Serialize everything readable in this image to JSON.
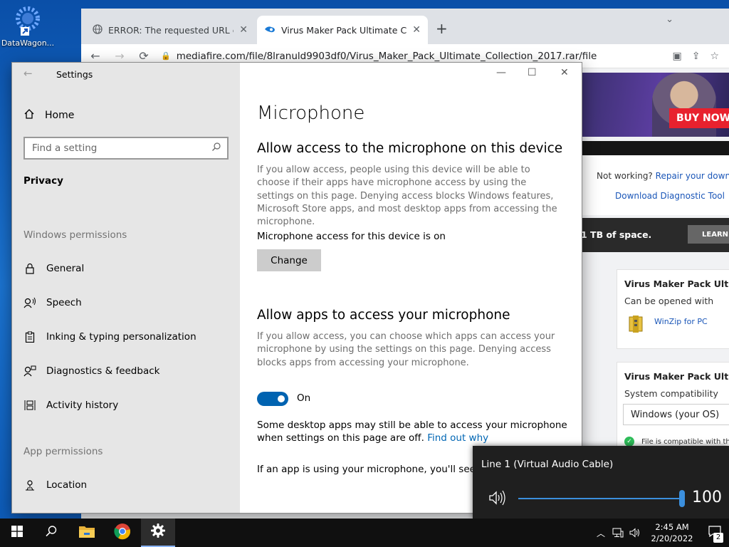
{
  "desktop": {
    "icon_label": "DataWagon..."
  },
  "browser": {
    "tabs": [
      {
        "title": "ERROR: The requested URL could",
        "active": false
      },
      {
        "title": "Virus Maker Pack Ultimate Collec",
        "active": true
      }
    ],
    "url": "mediafire.com/file/8lranuld9903df0/Virus_Maker_Pack_Ultimate_Collection_2017.rar/file"
  },
  "web": {
    "banner_cta": "BUY NOW",
    "not_working": "Not working?",
    "repair_link": "Repair your downloa",
    "diagnostic_link": "Download Diagnostic Tool",
    "space_text": "1 TB of space.",
    "learn_label": "LEARN",
    "card1": {
      "title": "Virus Maker Pack Ultima",
      "subtitle": "Can be opened with",
      "app_link": "WinZip for PC"
    },
    "card2": {
      "title": "Virus Maker Pack Ultima",
      "subtitle": "System compatibility",
      "os_value": "Windows (your OS)",
      "compat_text": "File is compatible with th"
    }
  },
  "settings": {
    "window_title": "Settings",
    "home_label": "Home",
    "search_placeholder": "Find a setting",
    "current_section": "Privacy",
    "windows_permissions_label": "Windows permissions",
    "windows_permissions": [
      "General",
      "Speech",
      "Inking & typing personalization",
      "Diagnostics & feedback",
      "Activity history"
    ],
    "app_permissions_label": "App permissions",
    "app_permissions": [
      "Location"
    ],
    "main": {
      "title": "Microphone",
      "device_heading": "Allow access to the microphone on this device",
      "device_desc": "If you allow access, people using this device will be able to choose if their apps have microphone access by using the settings on this page. Denying access blocks Windows features, Microsoft Store apps, and most desktop apps from accessing the microphone.",
      "device_status": "Microphone access for this device is on",
      "change_label": "Change",
      "apps_heading": "Allow apps to access your microphone",
      "apps_desc": "If you allow access, you can choose which apps can access your microphone by using the settings on this page. Denying access blocks apps from accessing your microphone.",
      "toggle_state": "On",
      "note_text": "Some desktop apps may still be able to access your microphone when settings on this page are off.",
      "note_link": "Find out why",
      "using_text": "If an app is using your microphone, you'll see this"
    }
  },
  "volume": {
    "device_name": "Line 1 (Virtual Audio Cable)",
    "level": 100
  },
  "taskbar": {
    "time": "2:45 AM",
    "date": "2/20/2022",
    "notification_count": "2"
  }
}
